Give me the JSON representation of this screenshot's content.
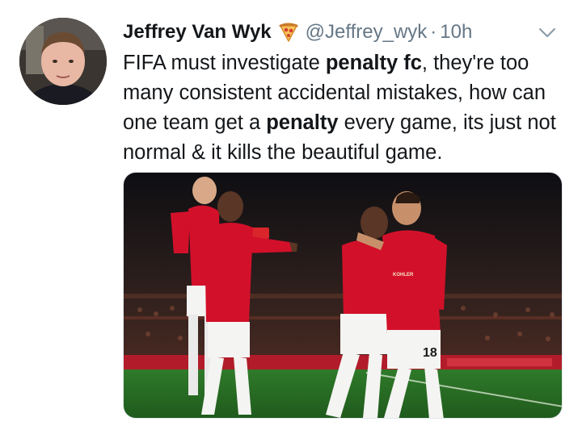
{
  "tweet": {
    "display_name": "Jeffrey Van Wyk",
    "name_emoji": "pizza-icon",
    "handle": "@Jeffrey_wyk",
    "separator": "·",
    "time": "10h",
    "text_segments": [
      {
        "text": "FIFA must investigate ",
        "bold": false
      },
      {
        "text": "penalty fc",
        "bold": true
      },
      {
        "text": ", they're too many consistent accidental mistakes, how can one team get a ",
        "bold": false
      },
      {
        "text": "penalty",
        "bold": true
      },
      {
        "text": " every game, its just not normal & it kills the beautiful game.",
        "bold": false
      }
    ],
    "photo": {
      "shirt_number": "18",
      "sponsor_text": "KOHLER"
    }
  },
  "colors": {
    "text": "#14171a",
    "secondary": "#657786",
    "kit_red": "#d3102a"
  },
  "icons": {
    "emoji": "pizza-icon",
    "menu": "chevron-down-icon"
  }
}
